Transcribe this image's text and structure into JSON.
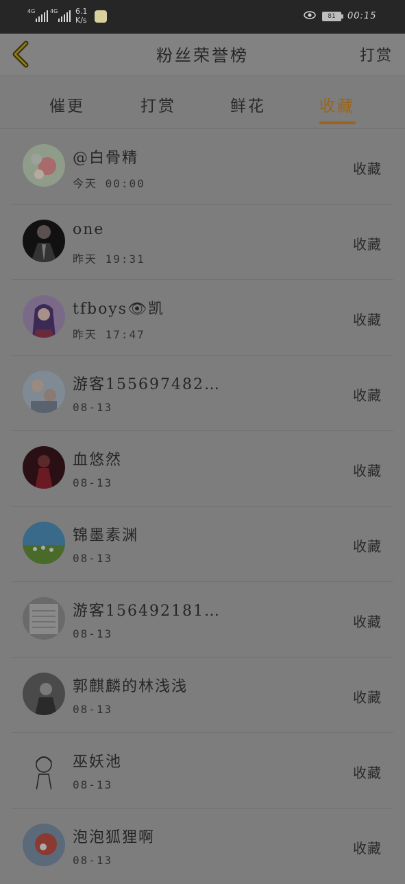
{
  "statusbar": {
    "sim1": "4G",
    "sim2": "4G",
    "net_speed": "6.1",
    "net_unit": "K/s",
    "battery": "81",
    "time": "00:15"
  },
  "header": {
    "title": "粉丝荣誉榜",
    "right_action": "打赏"
  },
  "tabs": [
    {
      "label": "催更"
    },
    {
      "label": "打赏"
    },
    {
      "label": "鲜花"
    },
    {
      "label": "收藏"
    }
  ],
  "active_tab": "收藏",
  "colors": {
    "accent": "#9c6418",
    "overlay_background": "#7d7d7d"
  },
  "rows": [
    {
      "name": "@白骨精",
      "time": "今天 00:00",
      "action": "收藏",
      "avatar_icon": "flowers-avatar"
    },
    {
      "name": "one",
      "time": "昨天 19:31",
      "action": "收藏",
      "avatar_icon": "suit-avatar"
    },
    {
      "name": "tfboys👁凯",
      "time": "昨天 17:47",
      "action": "收藏",
      "avatar_icon": "anime-girl-avatar"
    },
    {
      "name": "游客155697482…",
      "time": "08-13",
      "action": "收藏",
      "avatar_icon": "couple-avatar"
    },
    {
      "name": "血悠然",
      "time": "08-13",
      "action": "收藏",
      "avatar_icon": "dark-figure-avatar"
    },
    {
      "name": "锦墨素渊",
      "time": "08-13",
      "action": "收藏",
      "avatar_icon": "field-sky-avatar"
    },
    {
      "name": "游客156492181…",
      "time": "08-13",
      "action": "收藏",
      "avatar_icon": "notebook-avatar"
    },
    {
      "name": "郭麒麟的林浅浅",
      "time": "08-13",
      "action": "收藏",
      "avatar_icon": "bw-person-avatar"
    },
    {
      "name": "巫妖池",
      "time": "08-13",
      "action": "收藏",
      "avatar_icon": "sketch-boy-avatar"
    },
    {
      "name": "泡泡狐狸啊",
      "time": "08-13",
      "action": "收藏",
      "avatar_icon": "fox-avatar"
    }
  ]
}
